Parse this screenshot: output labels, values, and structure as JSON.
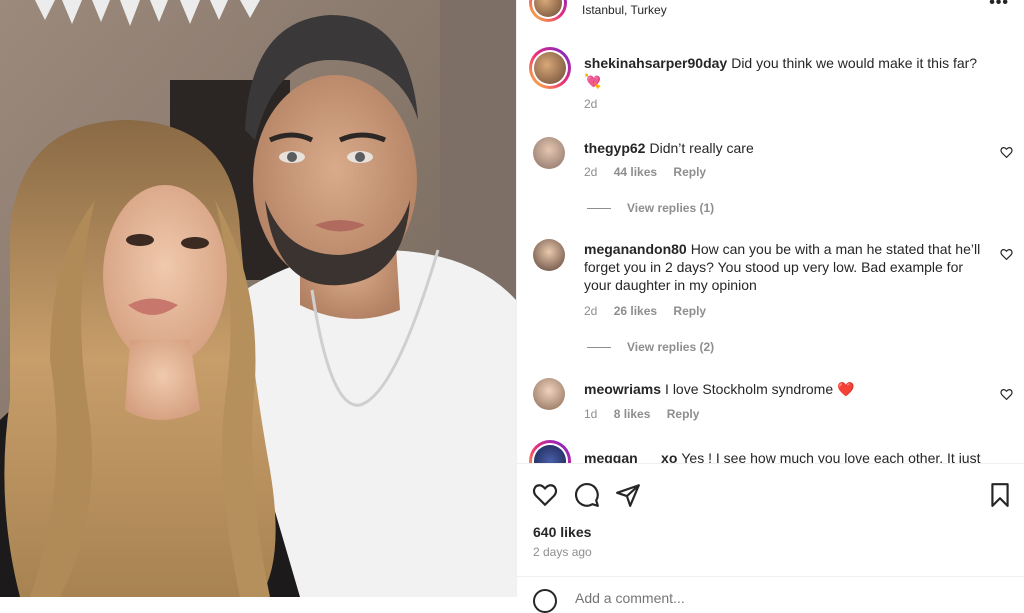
{
  "post": {
    "location": "Istanbul, Turkey",
    "more_icon": "•••",
    "likes": "640 likes",
    "date": "2 days ago",
    "add_comment_placeholder": "Add a comment..."
  },
  "caption": {
    "username": "shekinahsarper90day",
    "text": "Did you think we would make it this far?",
    "emoji": "💘",
    "time": "2d"
  },
  "comments": [
    {
      "username": "thegyp62",
      "text": "Didn’t really care",
      "time": "2d",
      "likes": "44 likes",
      "reply": "Reply",
      "view_replies": "View replies (1)"
    },
    {
      "username": "meganandon80",
      "text": "How can you be with a man he stated that he’ll forget you in 2 days? You stood up very low. Bad example for your daughter in my opinion",
      "time": "2d",
      "likes": "26 likes",
      "reply": "Reply",
      "view_replies": "View replies (2)"
    },
    {
      "username": "meowriams",
      "text": "I love Stockholm syndrome",
      "emoji": "❤️",
      "time": "1d",
      "likes": "8 likes",
      "reply": "Reply"
    },
    {
      "username": "meggan___xo",
      "text": "Yes ! I see how much you love each other. It just"
    }
  ],
  "colors": {
    "text": "#262626",
    "secondary": "#8e8e8e",
    "heart_emoji": "#e0245e"
  }
}
